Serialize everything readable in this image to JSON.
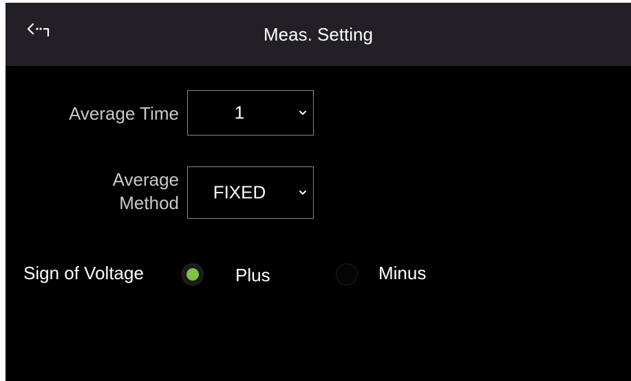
{
  "header": {
    "title": "Meas. Setting",
    "back_icon": "back-arrow-icon"
  },
  "average_time": {
    "label": "Average Time",
    "value": "1"
  },
  "average_method": {
    "label_line1": "Average",
    "label_line2": "Method",
    "value": "FIXED"
  },
  "sign_of_voltage": {
    "label": "Sign of Voltage",
    "options": [
      {
        "label": "Plus",
        "selected": true
      },
      {
        "label": "Minus",
        "selected": false
      }
    ]
  },
  "colors": {
    "header_bg": "#221f25",
    "screen_bg": "#000000",
    "accent_selected": "#7cc243"
  }
}
